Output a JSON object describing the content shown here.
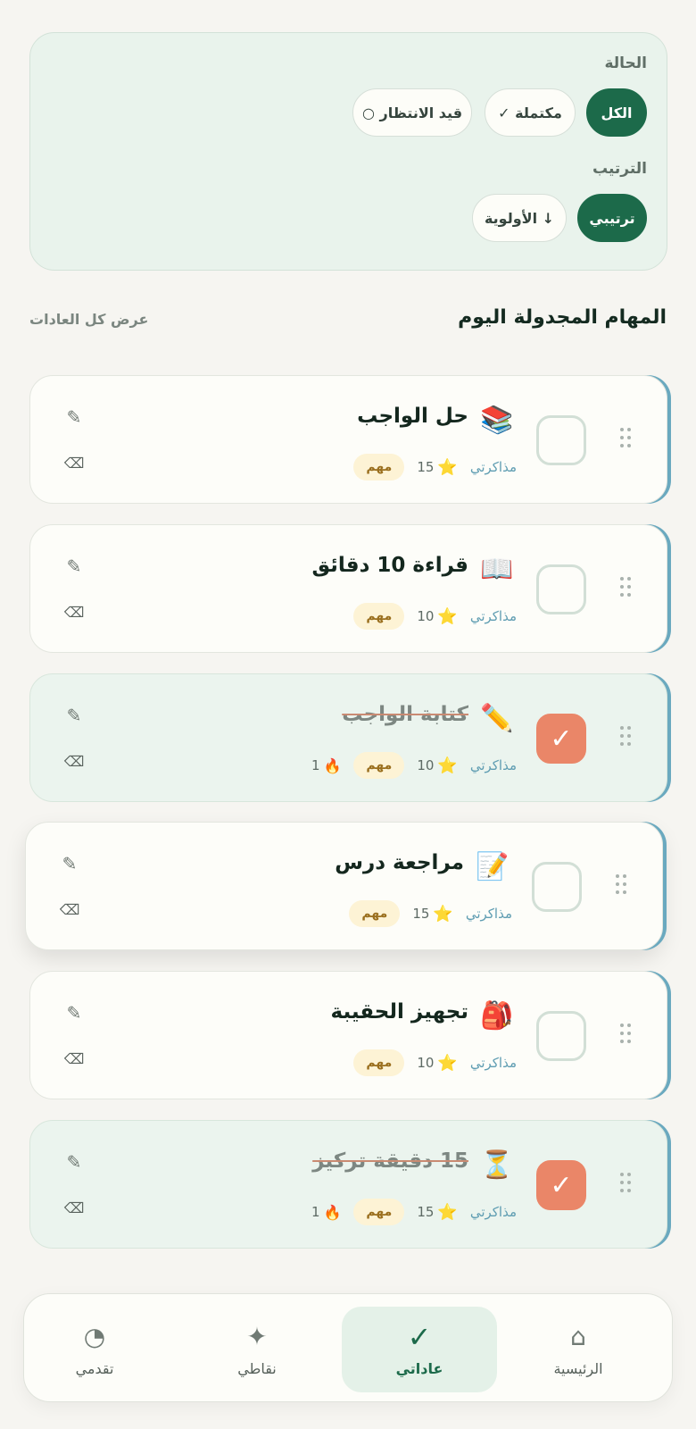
{
  "filters": {
    "status_label": "الحالة",
    "status_chips": [
      {
        "label": "الكل",
        "active": true
      },
      {
        "label": "✓ مكتملة",
        "active": false
      },
      {
        "label": "○ قيد الانتظار",
        "active": false
      }
    ],
    "sort_label": "الترتيب",
    "sort_chips": [
      {
        "label": "ترتيبي",
        "active": true
      },
      {
        "label": "الأولوية ↓",
        "active": false
      }
    ]
  },
  "section": {
    "title": "المهام المجدولة اليوم",
    "view_all": "عرض كل العادات"
  },
  "tasks": [
    {
      "emoji": "📚",
      "title": "حل الواجب",
      "category": "مذاكرتي",
      "points": "15",
      "priority": "مهم",
      "streak": "",
      "done": false
    },
    {
      "emoji": "📖",
      "title": "قراءة 10 دقائق",
      "category": "مذاكرتي",
      "points": "10",
      "priority": "مهم",
      "streak": "",
      "done": false
    },
    {
      "emoji": "✏️",
      "title": "كتابة الواجب",
      "category": "مذاكرتي",
      "points": "10",
      "priority": "مهم",
      "streak": "1",
      "done": true
    },
    {
      "emoji": "📝",
      "title": "مراجعة درس",
      "category": "مذاكرتي",
      "points": "15",
      "priority": "مهم",
      "streak": "",
      "done": false
    },
    {
      "emoji": "🎒",
      "title": "تجهيز الحقيبة",
      "category": "مذاكرتي",
      "points": "10",
      "priority": "مهم",
      "streak": "",
      "done": false
    },
    {
      "emoji": "⏳",
      "title": "15 دقيقة تركيز",
      "category": "مذاكرتي",
      "points": "15",
      "priority": "مهم",
      "streak": "1",
      "done": true
    }
  ],
  "icons": {
    "check": "✓",
    "star": "⭐",
    "fire": "🔥",
    "edit": "✎",
    "delete": "⌫"
  },
  "nav": {
    "items": [
      {
        "label": "الرئيسية",
        "icon": "⌂",
        "active": false
      },
      {
        "label": "عاداتي",
        "icon": "✓",
        "active": true
      },
      {
        "label": "نقاطي",
        "icon": "✦",
        "active": false
      },
      {
        "label": "تقدمي",
        "icon": "◔",
        "active": false
      }
    ]
  },
  "colors": {
    "primary": "#1c6a4a",
    "checked": "#ea8668",
    "accent_border": "#6aa9bf",
    "badge_bg": "#fdf3d5",
    "category": "#5f9db2"
  }
}
